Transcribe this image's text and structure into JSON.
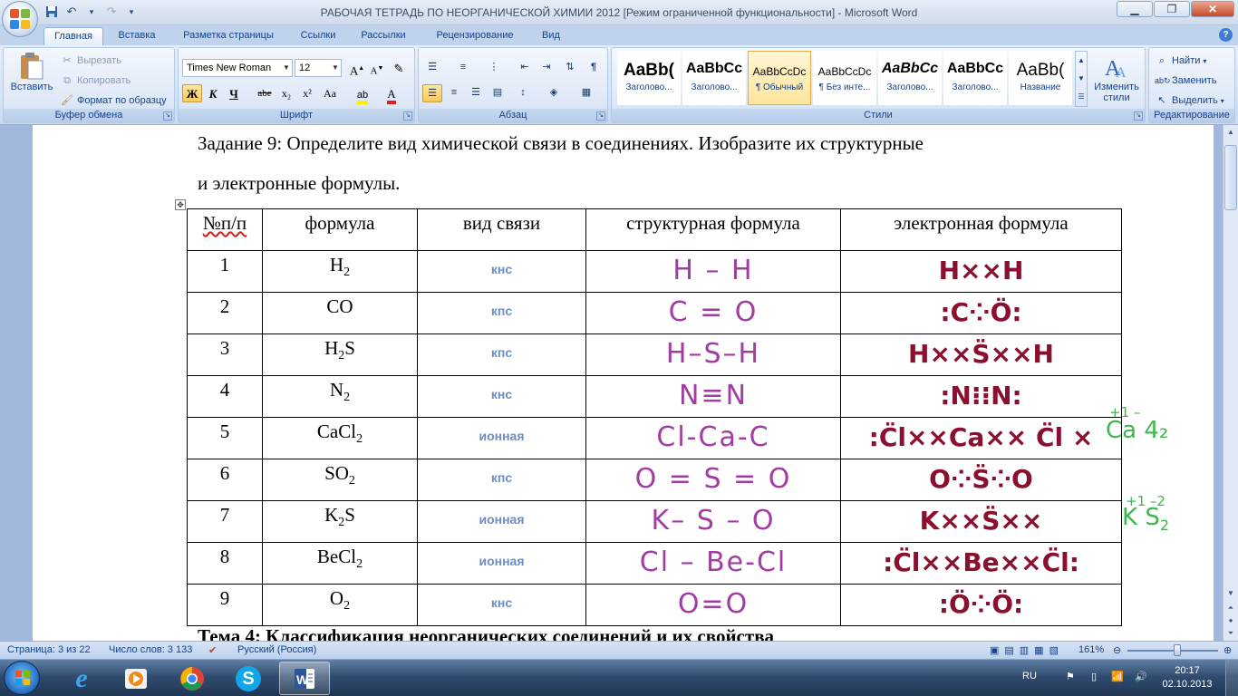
{
  "window": {
    "title": "РАБОЧАЯ ТЕТРАДЬ ПО НЕОРГАНИЧЕСКОЙ ХИМИИ 2012 [Режим ограниченной функциональности] - Microsoft Word"
  },
  "qat": {
    "save_icon": "save-icon",
    "undo_icon": "undo-icon",
    "redo_icon": "redo-icon",
    "customize_icon": "chevron-down-icon"
  },
  "tabs": [
    "Главная",
    "Вставка",
    "Разметка страницы",
    "Ссылки",
    "Рассылки",
    "Рецензирование",
    "Вид"
  ],
  "ribbon": {
    "clipboard": {
      "title": "Буфер обмена",
      "paste": "Вставить",
      "cut": "Вырезать",
      "copy": "Копировать",
      "format_painter": "Формат по образцу"
    },
    "font": {
      "title": "Шрифт",
      "font_name": "Times New Roman",
      "font_size": "12",
      "bold": "Ж",
      "italic": "К",
      "underline": "Ч",
      "strike": "abe",
      "sub": "x₂",
      "sup": "x²",
      "case": "Aa"
    },
    "paragraph": {
      "title": "Абзац"
    },
    "styles": {
      "title": "Стили",
      "items": [
        {
          "preview": "AaBb(",
          "name": "Заголово..."
        },
        {
          "preview": "AaBbCc",
          "name": "Заголово..."
        },
        {
          "preview": "AaBbCcDc",
          "name": "¶ Обычный"
        },
        {
          "preview": "AaBbCcDc",
          "name": "¶ Без инте..."
        },
        {
          "preview": "AaBbCc",
          "name": "Заголово..."
        },
        {
          "preview": "AaBbCc",
          "name": "Заголово..."
        },
        {
          "preview": "AaBb(",
          "name": "Название"
        }
      ],
      "change": "Изменить стили"
    },
    "editing": {
      "title": "Редактирование",
      "find": "Найти",
      "replace": "Заменить",
      "select": "Выделить"
    }
  },
  "document": {
    "task_line1": "Задание 9: Определите вид химической связи в соединениях. Изобразите их структурные",
    "task_line2": "и электронные формулы.",
    "headers": [
      "№п/п",
      "формула",
      "вид связи",
      "структурная формула",
      "электронная формула"
    ],
    "rows": [
      {
        "n": "1",
        "f": "H",
        "sub": "2",
        "f2": "",
        "sub2": "",
        "bond": "кнс",
        "struct": "H – H",
        "elec": "H××H"
      },
      {
        "n": "2",
        "f": "CO",
        "sub": "",
        "f2": "",
        "sub2": "",
        "bond": "кпс",
        "struct": "C = O",
        "elec": ":C⁘Ö:"
      },
      {
        "n": "3",
        "f": "H",
        "sub": "2",
        "f2": "S",
        "sub2": "",
        "bond": "кпс",
        "struct": "H–S–H",
        "elec": "H××S̈××H"
      },
      {
        "n": "4",
        "f": "N",
        "sub": "2",
        "f2": "",
        "sub2": "",
        "bond": "кнс",
        "struct": "N≡N",
        "elec": ":N⁝⁝N:"
      },
      {
        "n": "5",
        "f": "CaCl",
        "sub": "2",
        "f2": "",
        "sub2": "",
        "bond": "ионная",
        "struct": "Cl-Ca-C",
        "elec": ":C̈l××Ca×× C̈l ×"
      },
      {
        "n": "6",
        "f": "SO",
        "sub": "2",
        "f2": "",
        "sub2": "",
        "bond": "кпс",
        "struct": "O = S = O",
        "elec": "O⁘S̈⁘O"
      },
      {
        "n": "7",
        "f": "K",
        "sub": "2",
        "f2": "S",
        "sub2": "",
        "bond": "ионная",
        "struct": "K– S – O",
        "elec": "K××S̈××"
      },
      {
        "n": "8",
        "f": "BeCl",
        "sub": "2",
        "f2": "",
        "sub2": "",
        "bond": "ионная",
        "struct": "Cl – Be-Cl",
        "elec": ":C̈l××Be××C̈l:"
      },
      {
        "n": "9",
        "f": "O",
        "sub": "2",
        "f2": "",
        "sub2": "",
        "bond": "кнс",
        "struct": "O=O",
        "elec": ":Ö⁘Ö:"
      }
    ],
    "note1_sup": "+1  –",
    "note1": "Ca 4₂",
    "note2_sup": "+1 –2",
    "note2": "K S",
    "note2_sub": "2",
    "next_heading": "Тема 4: Классификация неорганических соединений и их свойства"
  },
  "status": {
    "page": "Страница: 3 из 22",
    "words": "Число слов: 3 133",
    "lang": "Русский (Россия)",
    "zoom": "161%"
  },
  "taskbar": {
    "lang": "RU",
    "time": "20:17",
    "date": "02.10.2013"
  },
  "colors": {
    "accent": "#15428b",
    "struct_ink": "#a23ca2",
    "elec_ink": "#8b0f2e",
    "note_ink": "#3bb84d",
    "bond_text": "#6b8ec6"
  }
}
